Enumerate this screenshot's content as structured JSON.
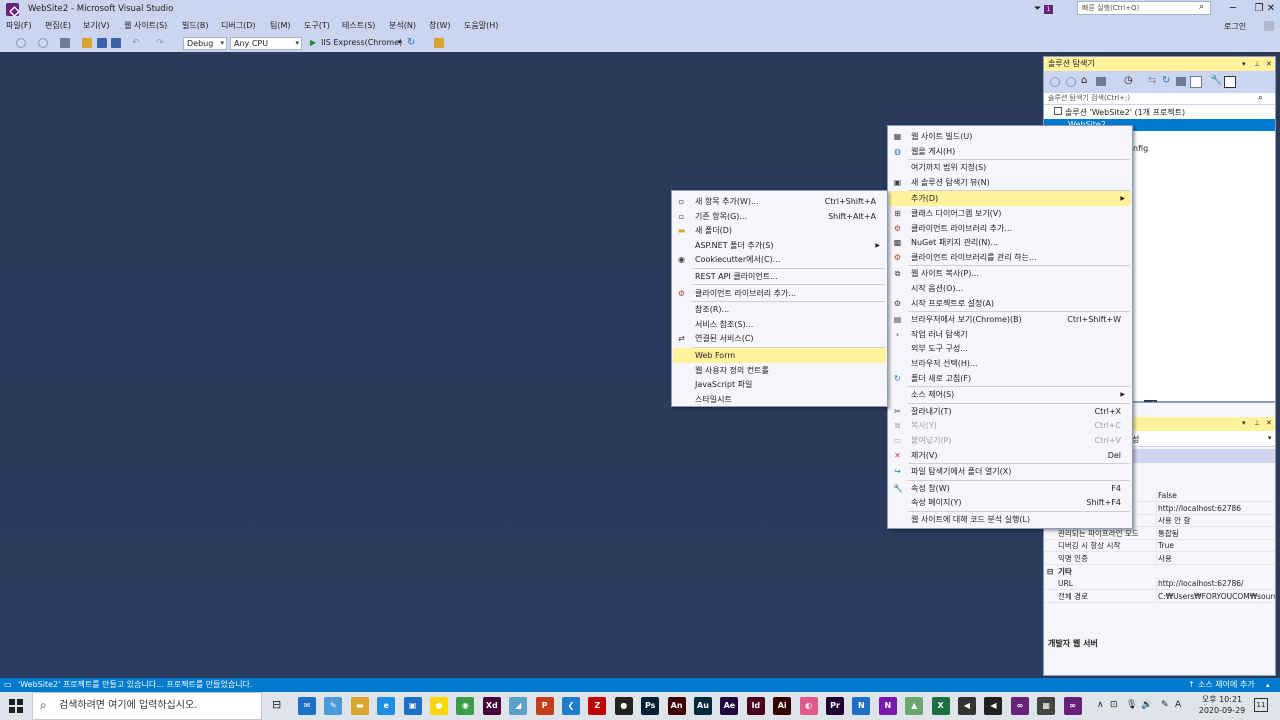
{
  "window": {
    "title": "WebSite2 - Microsoft Visual Studio",
    "quick_launch_placeholder": "빠른 실행(Ctrl+Q)",
    "login": "로그인",
    "notif_count": "1"
  },
  "menu": [
    "파일(F)",
    "편집(E)",
    "보기(V)",
    "웹 사이트(S)",
    "빌드(B)",
    "디버그(D)",
    "팀(M)",
    "도구(T)",
    "테스트(S)",
    "분석(N)",
    "창(W)",
    "도움말(H)"
  ],
  "toolbar": {
    "config": "Debug",
    "platform": "Any CPU",
    "run": "IIS Express(Chrome)"
  },
  "solution_explorer": {
    "title": "솔루션 탐색기",
    "search_placeholder": "솔루션 탐색기 검색(Ctrl+;)",
    "tree": [
      "솔루션 'WebSite2' (1개 프로젝트)",
      "WebSite2",
      "nfig"
    ],
    "tab_fragment": "기"
  },
  "properties": {
    "header_fragment": "성",
    "rows": [
      {
        "name": "",
        "value": "False"
      },
      {
        "name": "",
        "value": "http://localhost:62786"
      },
      {
        "name": "",
        "value": "사용 안 함"
      },
      {
        "name": "관리되는 파이프라인 모드",
        "value": "통합됨"
      },
      {
        "name": "디버깅 시 항상 시작",
        "value": "True"
      },
      {
        "name": "익명 인증",
        "value": "사용"
      }
    ],
    "category": "기타",
    "rows2": [
      {
        "name": "URL",
        "value": "http://localhost:62786/"
      },
      {
        "name": "전체 경로",
        "value": "C:₩Users₩FORYOUCOM₩source"
      }
    ],
    "description": "개발자 웹 서버"
  },
  "context_main": {
    "items": [
      {
        "label": "웹 사이트 빌드(U)",
        "shortcut": "",
        "icon": "build-icon",
        "sep_after": false
      },
      {
        "label": "웹을 게시(H)",
        "shortcut": "",
        "icon": "globe-icon",
        "sep_after": true
      },
      {
        "label": "여기까지 범위 지정(S)",
        "shortcut": "",
        "icon": "",
        "sep_after": false
      },
      {
        "label": "새 솔루션 탐색기 뷰(N)",
        "shortcut": "",
        "icon": "window-icon",
        "sep_after": true
      },
      {
        "label": "추가(D)",
        "shortcut": "",
        "icon": "",
        "sep_after": false,
        "highlighted": true,
        "submenu": true
      },
      {
        "label": "클래스 다이어그램 보기(V)",
        "shortcut": "",
        "icon": "diagram-icon",
        "sep_after": false
      },
      {
        "label": "클라이언트 라이브러리 추가...",
        "shortcut": "",
        "icon": "library-icon",
        "sep_after": false
      },
      {
        "label": "NuGet 패키지 관리(N)...",
        "shortcut": "",
        "icon": "nuget-icon",
        "sep_after": false
      },
      {
        "label": "클라이언트 라이브러리를 관리 하는...",
        "shortcut": "",
        "icon": "library-icon",
        "sep_after": true
      },
      {
        "label": "웹 사이트 복사(P)...",
        "shortcut": "",
        "icon": "copy-site-icon",
        "sep_after": false
      },
      {
        "label": "시작 옵션(O)...",
        "shortcut": "",
        "icon": "",
        "sep_after": false
      },
      {
        "label": "시작 프로젝트로 설정(A)",
        "shortcut": "",
        "icon": "gear-icon",
        "sep_after": true
      },
      {
        "label": "브라우저에서 보기(Chrome)(B)",
        "shortcut": "Ctrl+Shift+W",
        "icon": "browser-icon",
        "sep_after": false
      },
      {
        "label": "작업 러너 탐색기",
        "shortcut": "",
        "icon": "chevron-icon",
        "sep_after": false
      },
      {
        "label": "외부 도구 구성...",
        "shortcut": "",
        "icon": "",
        "sep_after": false
      },
      {
        "label": "브라우저 선택(H)...",
        "shortcut": "",
        "icon": "",
        "sep_after": false
      },
      {
        "label": "폴더 새로 고침(F)",
        "shortcut": "",
        "icon": "refresh-icon",
        "sep_after": true
      },
      {
        "label": "소스 제어(S)",
        "shortcut": "",
        "icon": "",
        "sep_after": true,
        "submenu": true
      },
      {
        "label": "잘라내기(T)",
        "shortcut": "Ctrl+X",
        "icon": "scissors-icon",
        "sep_after": false
      },
      {
        "label": "복사(Y)",
        "shortcut": "Ctrl+C",
        "icon": "copy-icon",
        "sep_after": false,
        "disabled": true
      },
      {
        "label": "붙여넣기(P)",
        "shortcut": "Ctrl+V",
        "icon": "paste-icon",
        "sep_after": false,
        "disabled": true
      },
      {
        "label": "제거(V)",
        "shortcut": "Del",
        "icon": "delete-icon",
        "sep_after": true
      },
      {
        "label": "파일 탐색기에서 폴더 열기(X)",
        "shortcut": "",
        "icon": "open-folder-icon",
        "sep_after": true
      },
      {
        "label": "속성 창(W)",
        "shortcut": "F4",
        "icon": "wrench-icon",
        "sep_after": false
      },
      {
        "label": "속성 페이지(Y)",
        "shortcut": "Shift+F4",
        "icon": "",
        "sep_after": true
      },
      {
        "label": "웹 사이트에 대해 코드 분석 실행(L)",
        "shortcut": "",
        "icon": "",
        "sep_after": false
      }
    ]
  },
  "context_add": {
    "items": [
      {
        "label": "새 항목 추가(W)...",
        "shortcut": "Ctrl+Shift+A",
        "icon": "new-item-icon",
        "sep_after": false
      },
      {
        "label": "기존 항목(G)...",
        "shortcut": "Shift+Alt+A",
        "icon": "existing-item-icon",
        "sep_after": false
      },
      {
        "label": "새 폴더(D)",
        "shortcut": "",
        "icon": "folder-icon",
        "sep_after": false
      },
      {
        "label": "ASP.NET 폴더 추가(S)",
        "shortcut": "",
        "icon": "",
        "sep_after": false,
        "submenu": true
      },
      {
        "label": "Cookiecutter에서(C)...",
        "shortcut": "",
        "icon": "cookie-icon",
        "sep_after": true
      },
      {
        "label": "REST API 클라이언트...",
        "shortcut": "",
        "icon": "",
        "sep_after": true
      },
      {
        "label": "클라이언트 라이브러리 추가...",
        "shortcut": "",
        "icon": "library-icon",
        "sep_after": true
      },
      {
        "label": "참조(R)...",
        "shortcut": "",
        "icon": "",
        "sep_after": false
      },
      {
        "label": "서비스 참조(S)...",
        "shortcut": "",
        "icon": "",
        "sep_after": false
      },
      {
        "label": "연결된 서비스(C)",
        "shortcut": "",
        "icon": "connected-service-icon",
        "sep_after": true
      },
      {
        "label": "Web Form",
        "shortcut": "",
        "icon": "",
        "sep_after": false,
        "highlighted": true
      },
      {
        "label": "웹 사용자 정의 컨트롤",
        "shortcut": "",
        "icon": "",
        "sep_after": false
      },
      {
        "label": "JavaScript 파일",
        "shortcut": "",
        "icon": "",
        "sep_after": false
      },
      {
        "label": "스타일시트",
        "shortcut": "",
        "icon": "",
        "sep_after": false
      }
    ]
  },
  "status": {
    "message": "'WebSite2' 프로젝트를 만들고 있습니다... 프로젝트를 만들었습니다.",
    "source_control": "소스 제어에 추가"
  },
  "taskbar": {
    "search_placeholder": "검색하려면 여기에 입력하십시오.",
    "time": "오후 10:21",
    "date": "2020-09-29",
    "notif": "11"
  },
  "colors": {
    "accent": "#007acc",
    "highlight": "#fff29d",
    "chrome": "#ccd5f0",
    "editor_bg": "#2b3a57"
  }
}
